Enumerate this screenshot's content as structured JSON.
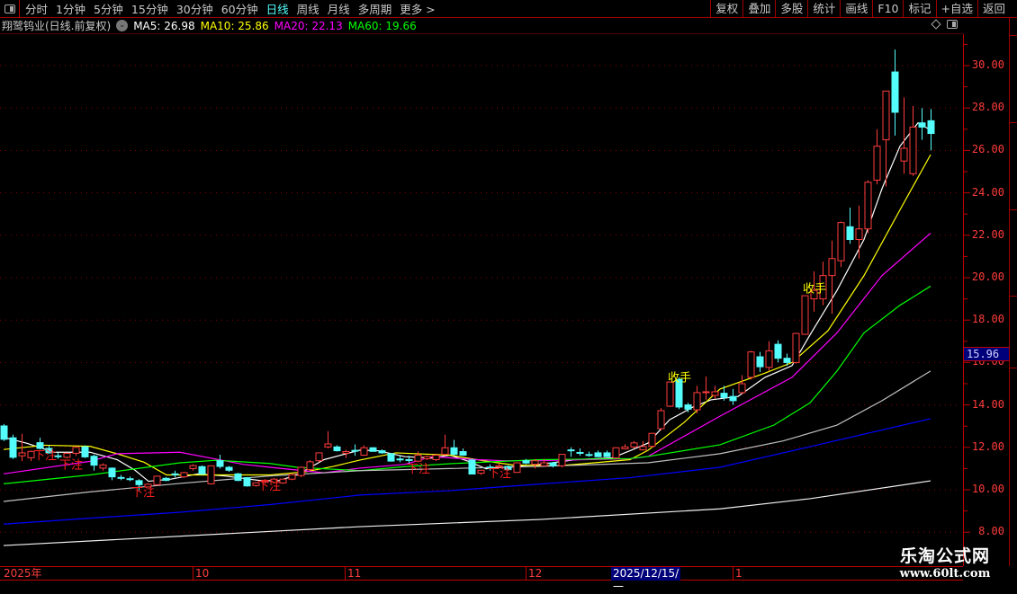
{
  "toolbar": {
    "periods": [
      "分时",
      "1分钟",
      "5分钟",
      "15分钟",
      "30分钟",
      "60分钟",
      "日线",
      "周线",
      "月线",
      "多周期",
      "更多 >"
    ],
    "active_period": "日线",
    "buttons": [
      "复权",
      "叠加",
      "多股",
      "统计",
      "画线",
      "F10",
      "标记",
      "+自选",
      "返回"
    ]
  },
  "info": {
    "stock": "翔鹭钨业(日线.前复权)",
    "ma5": "MA5: 26.98",
    "ma10": "MA10: 25.86",
    "ma20": "MA20: 22.13",
    "ma60": "MA60: 19.66"
  },
  "colors": {
    "up": "#ff3c3c",
    "down": "#54fcfc",
    "ma5": "#ffffff",
    "ma10": "#ffff00",
    "ma20": "#ff00ff",
    "ma60": "#00ff00",
    "ma_gray": "#c0c0c0",
    "ma_blue": "#0000ff",
    "ma_white2": "#f0f0f0",
    "grid": "#8b0000"
  },
  "current_price": "15.96",
  "xaxis": {
    "labels": [
      "2025年",
      "10",
      "11",
      "12",
      "2025/12/15/一",
      "1"
    ]
  },
  "watermark": {
    "name": "乐淘公式网",
    "url": "www.60lt.com"
  },
  "chart_data": {
    "type": "candlestick",
    "ylim": [
      7.5,
      31.5
    ],
    "yticks": [
      "30.00",
      "28.00",
      "26.00",
      "24.00",
      "22.00",
      "20.00",
      "18.00",
      "16.00",
      "14.00",
      "12.00",
      "10.00",
      "8.00"
    ],
    "ohlc": [
      [
        13.01,
        13.1,
        12.3,
        12.38
      ],
      [
        12.45,
        12.6,
        11.45,
        11.53
      ],
      [
        11.6,
        12.64,
        11.35,
        11.74
      ],
      [
        11.51,
        11.85,
        11.35,
        11.81
      ],
      [
        12.22,
        12.45,
        11.9,
        11.95
      ],
      [
        11.95,
        12.1,
        11.7,
        11.74
      ],
      [
        11.6,
        11.75,
        11.45,
        11.58
      ],
      [
        11.53,
        11.75,
        11.48,
        11.72
      ],
      [
        11.72,
        12.05,
        11.6,
        12.0
      ],
      [
        12.02,
        12.1,
        11.5,
        11.55
      ],
      [
        11.58,
        11.65,
        10.9,
        11.16
      ],
      [
        11.02,
        11.25,
        10.9,
        11.17
      ],
      [
        11.02,
        11.05,
        10.45,
        10.61
      ],
      [
        10.58,
        10.7,
        10.45,
        10.57
      ],
      [
        10.52,
        10.62,
        10.4,
        10.5
      ],
      [
        10.43,
        10.5,
        9.98,
        10.24
      ],
      [
        10.13,
        10.3,
        10.1,
        10.26
      ],
      [
        10.24,
        10.66,
        10.2,
        10.64
      ],
      [
        10.54,
        10.6,
        10.4,
        10.44
      ],
      [
        10.75,
        10.9,
        10.58,
        10.74
      ],
      [
        10.61,
        10.85,
        10.55,
        10.81
      ],
      [
        11.0,
        11.2,
        10.9,
        11.14
      ],
      [
        11.09,
        11.15,
        10.7,
        10.75
      ],
      [
        10.28,
        11.15,
        10.25,
        11.13
      ],
      [
        11.37,
        11.65,
        11.0,
        11.1
      ],
      [
        11.06,
        11.12,
        10.85,
        10.92
      ],
      [
        10.75,
        10.8,
        10.4,
        10.44
      ],
      [
        10.57,
        10.6,
        10.15,
        10.18
      ],
      [
        10.2,
        10.36,
        10.15,
        10.33
      ],
      [
        10.35,
        10.5,
        10.3,
        10.45
      ],
      [
        10.35,
        10.55,
        10.3,
        10.5
      ],
      [
        10.32,
        10.52,
        10.28,
        10.5
      ],
      [
        10.5,
        10.75,
        10.45,
        10.71
      ],
      [
        10.67,
        11.1,
        10.6,
        11.06
      ],
      [
        10.95,
        11.4,
        10.9,
        11.32
      ],
      [
        11.37,
        11.76,
        11.3,
        11.74
      ],
      [
        12.02,
        12.76,
        11.95,
        12.16
      ],
      [
        12.02,
        12.1,
        11.8,
        11.84
      ],
      [
        11.72,
        11.88,
        11.5,
        11.8
      ],
      [
        11.86,
        12.14,
        11.6,
        11.84
      ],
      [
        11.63,
        12.1,
        11.6,
        11.98
      ],
      [
        11.98,
        12.0,
        11.8,
        11.81
      ],
      [
        11.84,
        11.9,
        11.7,
        11.74
      ],
      [
        11.7,
        11.72,
        11.33,
        11.35
      ],
      [
        11.45,
        11.6,
        11.3,
        11.44
      ],
      [
        11.42,
        11.6,
        11.25,
        11.41
      ],
      [
        11.35,
        11.8,
        11.3,
        11.63
      ],
      [
        11.46,
        11.62,
        11.4,
        11.56
      ],
      [
        11.42,
        11.7,
        11.35,
        11.63
      ],
      [
        11.67,
        12.6,
        11.6,
        11.98
      ],
      [
        11.98,
        12.35,
        11.6,
        11.67
      ],
      [
        11.8,
        11.95,
        11.6,
        11.63
      ],
      [
        11.4,
        11.45,
        10.74,
        10.74
      ],
      [
        10.78,
        10.92,
        10.7,
        10.92
      ],
      [
        11.07,
        11.2,
        10.9,
        11.05
      ],
      [
        11.08,
        11.25,
        11.0,
        11.13
      ],
      [
        11.1,
        11.15,
        10.9,
        10.95
      ],
      [
        10.82,
        11.3,
        10.8,
        11.27
      ],
      [
        11.37,
        11.45,
        11.2,
        11.26
      ],
      [
        11.2,
        11.45,
        11.0,
        11.37
      ],
      [
        11.13,
        11.45,
        11.1,
        11.27
      ],
      [
        11.27,
        11.32,
        11.05,
        11.13
      ],
      [
        11.13,
        11.67,
        11.05,
        11.67
      ],
      [
        11.88,
        12.0,
        11.55,
        11.86
      ],
      [
        11.76,
        11.95,
        11.6,
        11.75
      ],
      [
        11.66,
        11.8,
        11.55,
        11.65
      ],
      [
        11.74,
        11.85,
        11.55,
        11.56
      ],
      [
        11.74,
        11.85,
        11.55,
        11.56
      ],
      [
        11.5,
        12.0,
        11.45,
        11.98
      ],
      [
        11.93,
        12.15,
        11.9,
        12.02
      ],
      [
        12.02,
        12.3,
        11.95,
        12.21
      ],
      [
        11.88,
        12.3,
        11.85,
        12.04
      ],
      [
        12.05,
        12.68,
        12.0,
        12.66
      ],
      [
        12.88,
        13.85,
        12.8,
        13.73
      ],
      [
        13.94,
        15.1,
        13.9,
        15.08
      ],
      [
        15.2,
        15.3,
        13.8,
        13.9
      ],
      [
        14.0,
        14.1,
        13.65,
        13.8
      ],
      [
        13.77,
        14.9,
        13.6,
        14.58
      ],
      [
        14.6,
        15.34,
        14.25,
        14.62
      ],
      [
        14.45,
        14.9,
        14.3,
        14.62
      ],
      [
        14.55,
        14.9,
        14.2,
        14.35
      ],
      [
        14.4,
        14.75,
        14.0,
        14.2
      ],
      [
        14.58,
        15.4,
        14.5,
        15.0
      ],
      [
        15.3,
        16.55,
        15.2,
        16.5
      ],
      [
        16.27,
        16.5,
        15.55,
        15.8
      ],
      [
        15.77,
        17.0,
        15.6,
        16.55
      ],
      [
        16.86,
        17.05,
        16.0,
        16.2
      ],
      [
        16.2,
        16.42,
        15.85,
        16.0
      ],
      [
        16.0,
        17.4,
        15.95,
        17.37
      ],
      [
        17.33,
        19.15,
        17.3,
        19.15
      ],
      [
        19.0,
        20.3,
        18.4,
        19.4
      ],
      [
        19.0,
        20.75,
        18.7,
        20.1
      ],
      [
        20.1,
        21.75,
        18.3,
        20.9
      ],
      [
        20.8,
        22.65,
        20.5,
        22.6
      ],
      [
        22.4,
        23.3,
        21.6,
        21.8
      ],
      [
        21.8,
        23.4,
        20.9,
        22.3
      ],
      [
        22.3,
        24.6,
        22.1,
        24.5
      ],
      [
        24.6,
        27.0,
        24.4,
        26.2
      ],
      [
        26.5,
        28.8,
        24.3,
        28.8
      ],
      [
        29.7,
        30.76,
        26.7,
        27.8
      ],
      [
        25.5,
        28.5,
        24.9,
        26.1
      ],
      [
        24.9,
        28.1,
        24.8,
        27.1
      ],
      [
        27.3,
        28.0,
        26.5,
        27.1
      ],
      [
        27.4,
        27.95,
        26.0,
        26.8
      ]
    ],
    "lines": [
      {
        "name": "MA5",
        "color": "#ffffff",
        "points": [
          [
            0,
            12.47
          ],
          [
            2.6,
            12.19
          ],
          [
            5.6,
            11.77
          ],
          [
            9.6,
            11.77
          ],
          [
            12.6,
            11.42
          ],
          [
            14.6,
            10.92
          ],
          [
            16.1,
            10.4
          ],
          [
            18.6,
            10.5
          ],
          [
            21.6,
            10.75
          ],
          [
            24.6,
            10.65
          ],
          [
            28.6,
            10.43
          ],
          [
            30.6,
            10.43
          ],
          [
            32.6,
            10.7
          ],
          [
            35.6,
            11.42
          ],
          [
            39.6,
            11.87
          ],
          [
            41.6,
            11.84
          ],
          [
            44.6,
            11.56
          ],
          [
            47.6,
            11.5
          ],
          [
            49.6,
            11.63
          ],
          [
            51.6,
            11.35
          ],
          [
            53.6,
            10.99
          ],
          [
            55.6,
            11.06
          ],
          [
            59.6,
            11.2
          ],
          [
            63.6,
            11.42
          ],
          [
            67.6,
            11.5
          ],
          [
            69.6,
            11.84
          ],
          [
            71.6,
            12.2
          ],
          [
            74,
            13.3
          ],
          [
            76.6,
            13.9
          ],
          [
            78.6,
            14.24
          ],
          [
            81.6,
            14.4
          ],
          [
            84.6,
            15.3
          ],
          [
            87.6,
            15.85
          ],
          [
            89.6,
            17.3
          ],
          [
            92.6,
            19.4
          ],
          [
            95.6,
            21.8
          ],
          [
            97.6,
            24.2
          ],
          [
            99.6,
            26.2
          ],
          [
            101.6,
            27.3
          ],
          [
            103,
            26.96
          ]
        ]
      },
      {
        "name": "MA10",
        "color": "#ffff00",
        "points": [
          [
            0,
            11.9
          ],
          [
            4.6,
            12.1
          ],
          [
            9.6,
            12.05
          ],
          [
            12.6,
            11.7
          ],
          [
            15.6,
            11.3
          ],
          [
            18.1,
            10.7
          ],
          [
            24.6,
            10.7
          ],
          [
            29.6,
            10.7
          ],
          [
            33.6,
            10.85
          ],
          [
            36.6,
            11.1
          ],
          [
            39.6,
            11.4
          ],
          [
            43.6,
            11.74
          ],
          [
            49.6,
            11.63
          ],
          [
            53.6,
            11.35
          ],
          [
            56.6,
            11.17
          ],
          [
            61.6,
            11.13
          ],
          [
            65.6,
            11.27
          ],
          [
            69.6,
            11.42
          ],
          [
            71.6,
            11.86
          ],
          [
            75.6,
            13.17
          ],
          [
            79.6,
            14.75
          ],
          [
            84.6,
            15.5
          ],
          [
            87.6,
            16.0
          ],
          [
            91.6,
            17.5
          ],
          [
            95.6,
            20.1
          ],
          [
            99.6,
            23.2
          ],
          [
            103,
            25.8
          ]
        ]
      },
      {
        "name": "MA20",
        "color": "#ff00ff",
        "points": [
          [
            0,
            10.75
          ],
          [
            9.6,
            11.34
          ],
          [
            12.6,
            11.7
          ],
          [
            19.6,
            11.77
          ],
          [
            26.6,
            11.2
          ],
          [
            29.6,
            11.06
          ],
          [
            35.6,
            10.8
          ],
          [
            39.6,
            11.02
          ],
          [
            44.6,
            11.2
          ],
          [
            47.6,
            11.56
          ],
          [
            52.6,
            11.42
          ],
          [
            55.6,
            11.37
          ],
          [
            59.6,
            11.37
          ],
          [
            64.6,
            11.42
          ],
          [
            69.6,
            11.46
          ],
          [
            71.6,
            11.57
          ],
          [
            79.6,
            13.47
          ],
          [
            87.6,
            15.3
          ],
          [
            92.6,
            17.4
          ],
          [
            97.6,
            20.1
          ],
          [
            103,
            22.1
          ]
        ]
      },
      {
        "name": "MA60",
        "color": "#00ff00",
        "points": [
          [
            0,
            10.28
          ],
          [
            9.6,
            10.7
          ],
          [
            19.6,
            11.27
          ],
          [
            23.6,
            11.39
          ],
          [
            29.6,
            11.24
          ],
          [
            32.6,
            11.06
          ],
          [
            39.6,
            10.9
          ],
          [
            44.6,
            11.09
          ],
          [
            49.6,
            11.23
          ],
          [
            59.6,
            11.42
          ],
          [
            69.6,
            11.47
          ],
          [
            71.6,
            11.57
          ],
          [
            79.6,
            12.12
          ],
          [
            85.6,
            13.05
          ],
          [
            89.6,
            14.1
          ],
          [
            92.6,
            15.6
          ],
          [
            95.6,
            17.4
          ],
          [
            99.6,
            18.7
          ],
          [
            103,
            19.6
          ]
        ]
      },
      {
        "name": "MA-gray",
        "color": "#c0c0c0",
        "points": [
          [
            0,
            9.45
          ],
          [
            9.6,
            9.9
          ],
          [
            19.6,
            10.3
          ],
          [
            29.6,
            10.65
          ],
          [
            39.6,
            10.9
          ],
          [
            49.6,
            11.0
          ],
          [
            59.6,
            11.1
          ],
          [
            71.6,
            11.27
          ],
          [
            79.6,
            11.7
          ],
          [
            86.6,
            12.3
          ],
          [
            92.6,
            13.05
          ],
          [
            97.6,
            14.2
          ],
          [
            103,
            15.6
          ]
        ]
      },
      {
        "name": "MA-blue",
        "color": "#0000ff",
        "points": [
          [
            0,
            8.38
          ],
          [
            9.6,
            8.66
          ],
          [
            19.6,
            8.94
          ],
          [
            29.6,
            9.3
          ],
          [
            39.6,
            9.75
          ],
          [
            49.6,
            9.96
          ],
          [
            59.6,
            10.27
          ],
          [
            69.6,
            10.57
          ],
          [
            79.6,
            11.06
          ],
          [
            89.6,
            12.03
          ],
          [
            103,
            13.35
          ]
        ]
      },
      {
        "name": "MA-white2",
        "color": "#f0f0f0",
        "points": [
          [
            0,
            7.37
          ],
          [
            39.6,
            8.26
          ],
          [
            59.6,
            8.6
          ],
          [
            79.6,
            9.1
          ],
          [
            89.6,
            9.58
          ],
          [
            103,
            10.42
          ]
        ]
      }
    ],
    "annotations": [
      {
        "text": "下注",
        "i": 4.6,
        "price": 11.45,
        "color": "#ff2020"
      },
      {
        "text": "下注",
        "i": 7.5,
        "price": 11.0,
        "color": "#ff2020"
      },
      {
        "text": "下注",
        "i": 15.5,
        "price": 9.7,
        "color": "#ff2020"
      },
      {
        "text": "下注",
        "i": 29.5,
        "price": 10.0,
        "color": "#ff2020"
      },
      {
        "text": "下注",
        "i": 46.1,
        "price": 10.8,
        "color": "#ff2020"
      },
      {
        "text": "下注",
        "i": 55.1,
        "price": 10.6,
        "color": "#ff2020"
      },
      {
        "text": "收手",
        "i": 75.1,
        "price": 15.1,
        "color": "#ffff00"
      },
      {
        "text": "收手",
        "i": 90.1,
        "price": 19.3,
        "color": "#ffff00"
      }
    ]
  }
}
